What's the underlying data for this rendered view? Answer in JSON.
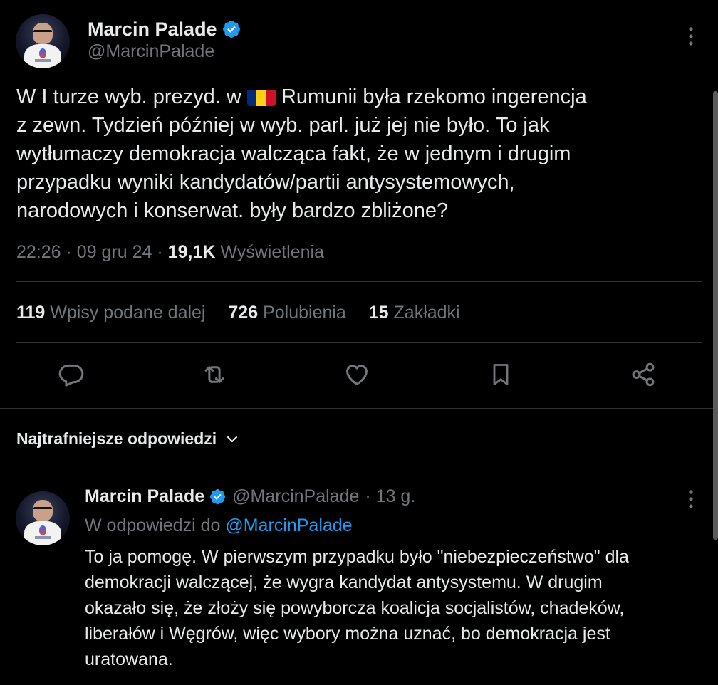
{
  "main_tweet": {
    "author_name": "Marcin Palade",
    "author_handle": "@MarcinPalade",
    "text_before_flag": "W I turze wyb. prezyd. w ",
    "text_after_flag_line1": " Rumunii była rzekomo ingerencja",
    "text_rest": "z zewn. Tydzień później w wyb. parl. już jej nie było. To jak\nwytłumaczy demokracja walcząca fakt, że w jednym i drugim\nprzypadku wyniki kandydatów/partii antysystemowych,\nnarodowych i konserwat. były bardzo zbliżone?",
    "flag_colors": [
      "#002B7F",
      "#FCD116",
      "#CE1126"
    ],
    "time": "22:26",
    "date": "09 gru 24",
    "views_count": "19,1K",
    "views_label": "Wyświetlenia",
    "separator": "·"
  },
  "stats": {
    "reposts_count": "119",
    "reposts_label": "Wpisy podane dalej",
    "likes_count": "726",
    "likes_label": "Polubienia",
    "bookmarks_count": "15",
    "bookmarks_label": "Zakładki"
  },
  "replies_header": {
    "label": "Najtrafniejsze odpowiedzi"
  },
  "reply": {
    "author_name": "Marcin Palade",
    "author_handle": "@MarcinPalade",
    "age": "· 13 g.",
    "replying_to_label": "W odpowiedzi do",
    "replying_to_handle": "@MarcinPalade",
    "text": "To ja pomogę. W pierwszym przypadku było \"niebezpieczeństwo\" dla\ndemokracji walczącej, że wygra kandydat antysystemu. W drugim\nokazało się, że złoży się powyborcza koalicja socjalistów, chadeków,\nliberałów i Węgrów, więc wybory można uznać, bo demokracja jest\nuratowana."
  },
  "colors": {
    "background": "#000000",
    "text": "#e7e9ea",
    "muted": "#71767b",
    "accent": "#1d9bf0",
    "divider": "#2f3336"
  },
  "icons": [
    "verified-badge-icon",
    "more-options-icon",
    "reply-icon",
    "repost-icon",
    "like-icon",
    "bookmark-icon",
    "share-icon",
    "chevron-down-icon"
  ]
}
